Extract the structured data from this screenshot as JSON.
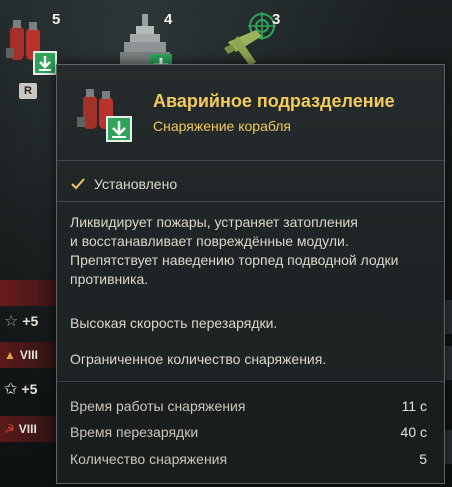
{
  "slots": [
    {
      "count": "5",
      "icon": "damage-control-party-icon"
    },
    {
      "count": "4",
      "icon": "ship-repair-icon"
    },
    {
      "count": "3",
      "icon": "fighter-plane-icon"
    }
  ],
  "hotkey": "R",
  "left_panel": {
    "tier_rows": [
      "VIII",
      "VIII"
    ],
    "bonus_rows": [
      "+5",
      "+5"
    ]
  },
  "tooltip": {
    "title": "Аварийное подразделение",
    "subtitle": "Снаряжение корабля",
    "status": "Установлено",
    "description": [
      "Ликвидирует пожары, устраняет затопления",
      "и восстанавливает повреждённые модули.",
      "Препятствует наведению торпед подводной лодки",
      "противника."
    ],
    "note_reload": "Высокая скорость перезарядки.",
    "note_limited": "Ограниченное количество снаряжения.",
    "stats": [
      {
        "label": "Время работы снаряжения",
        "value": "11 с"
      },
      {
        "label": "Время перезарядки",
        "value": "40 с"
      },
      {
        "label": "Количество снаряжения",
        "value": "5"
      }
    ]
  },
  "colors": {
    "title_gold": "#f2ca5c",
    "accent_green": "#2fa35a",
    "extinguisher_red": "#b8332b"
  }
}
